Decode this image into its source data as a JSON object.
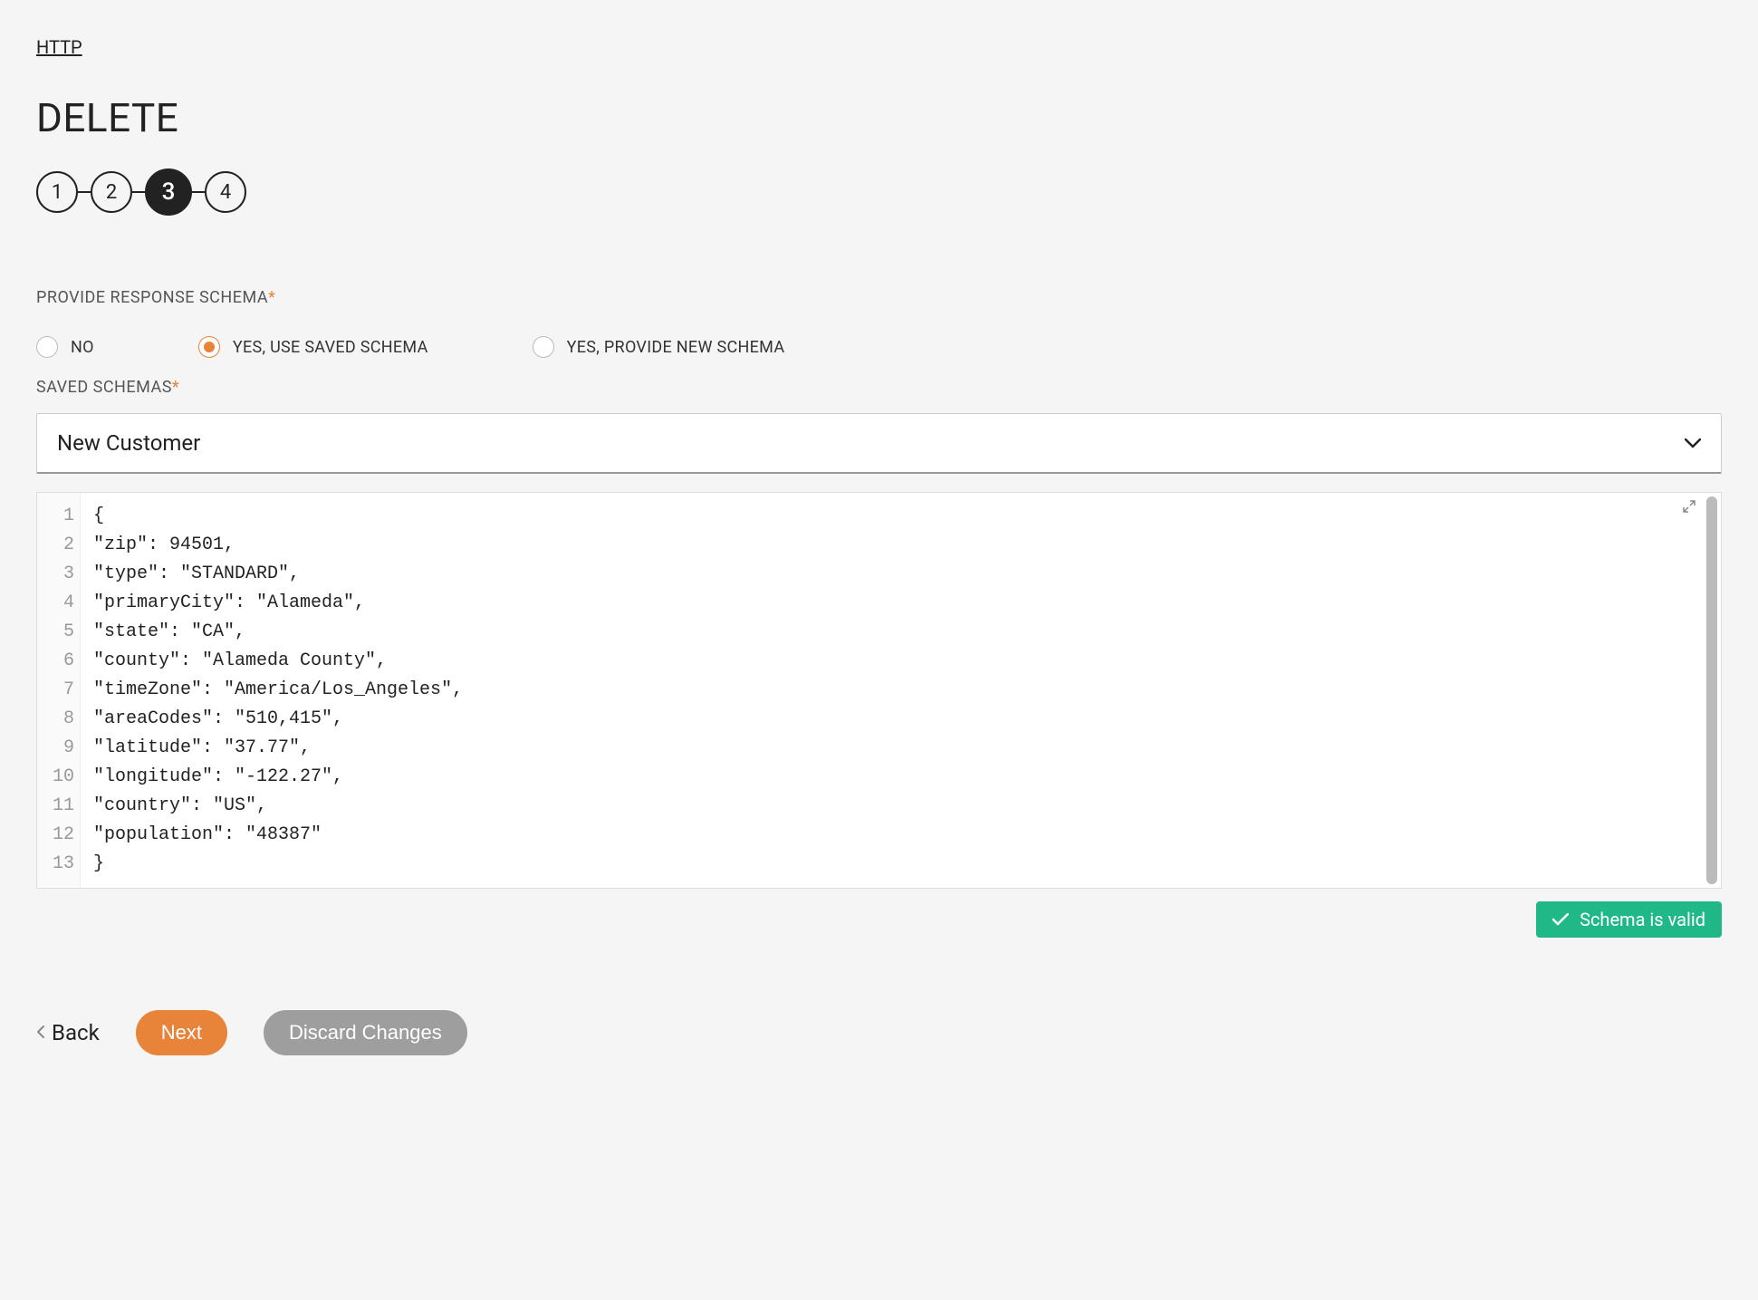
{
  "breadcrumb": {
    "label": "HTTP"
  },
  "page": {
    "title": "DELETE"
  },
  "stepper": {
    "steps": [
      "1",
      "2",
      "3",
      "4"
    ],
    "active_index": 2
  },
  "section": {
    "label": "PROVIDE RESPONSE SCHEMA",
    "required_mark": "*"
  },
  "radio": {
    "options": [
      {
        "label": "NO",
        "selected": false
      },
      {
        "label": "YES, USE SAVED SCHEMA",
        "selected": true
      },
      {
        "label": "YES, PROVIDE NEW SCHEMA",
        "selected": false
      }
    ]
  },
  "saved_schemas": {
    "label": "SAVED SCHEMAS",
    "required_mark": "*",
    "selected": "New Customer"
  },
  "editor": {
    "lines": [
      "{",
      "\"zip\": 94501,",
      "\"type\": \"STANDARD\",",
      "\"primaryCity\": \"Alameda\",",
      "\"state\": \"CA\",",
      "\"county\": \"Alameda County\",",
      "\"timeZone\": \"America/Los_Angeles\",",
      "\"areaCodes\": \"510,415\",",
      "\"latitude\": \"37.77\",",
      "\"longitude\": \"-122.27\",",
      "\"country\": \"US\",",
      "\"population\": \"48387\"",
      "}"
    ],
    "line_numbers": [
      "1",
      "2",
      "3",
      "4",
      "5",
      "6",
      "7",
      "8",
      "9",
      "10",
      "11",
      "12",
      "13"
    ]
  },
  "status": {
    "text": "Schema is valid"
  },
  "actions": {
    "back": "Back",
    "next": "Next",
    "discard": "Discard Changes"
  }
}
